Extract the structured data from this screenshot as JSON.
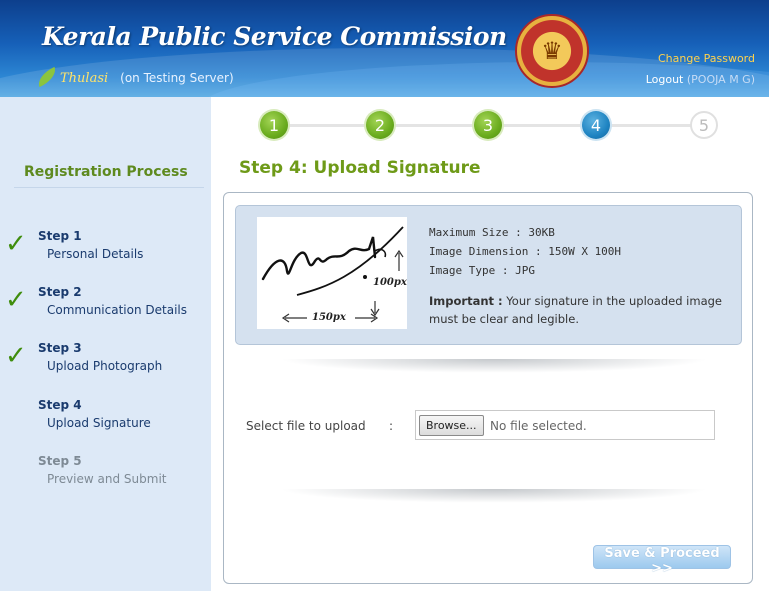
{
  "header": {
    "title": "Kerala Public Service Commission",
    "brand": "Thulasi",
    "server": "(on Testing Server)",
    "change_password": "Change Password",
    "logout_label": "Logout",
    "user": "(POOJA M G)"
  },
  "sidebar": {
    "title": "Registration Process",
    "steps": [
      {
        "title": "Step 1",
        "subtitle": "Personal Details",
        "status": "completed"
      },
      {
        "title": "Step 2",
        "subtitle": "Communication Details",
        "status": "completed"
      },
      {
        "title": "Step 3",
        "subtitle": "Upload Photograph",
        "status": "completed"
      },
      {
        "title": "Step 4",
        "subtitle": "Upload Signature",
        "status": "current"
      },
      {
        "title": "Step 5",
        "subtitle": "Preview and Submit",
        "status": "pending"
      }
    ]
  },
  "progress": {
    "steps": [
      "1",
      "2",
      "3",
      "4",
      "5"
    ],
    "current": 4
  },
  "main": {
    "title": "Step 4: Upload Signature",
    "sample": {
      "height_label": "100px",
      "width_label": "150px"
    },
    "info": {
      "max_size": "Maximum Size : 30KB",
      "dimension": "Image Dimension : 150W X 100H",
      "type": "Image Type : JPG",
      "important_label": "Important :",
      "important_text": "Your signature in the uploaded image must be clear and legible."
    },
    "upload": {
      "label": "Select file to upload",
      "colon": ":",
      "browse": "Browse...",
      "status": "No file selected."
    },
    "save_button": "Save & Proceed >>"
  },
  "colors": {
    "done": "#6aac1e",
    "active": "#1f84c2",
    "title_green": "#6e9a18"
  }
}
